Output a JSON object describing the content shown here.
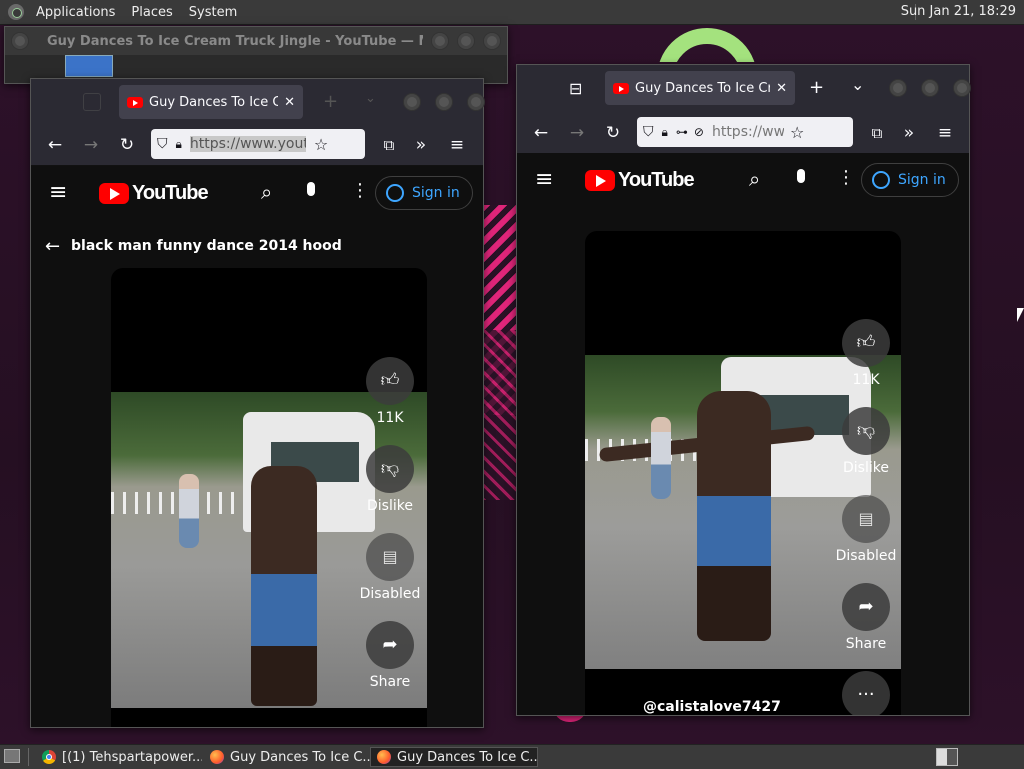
{
  "top_panel": {
    "applications": "Applications",
    "places": "Places",
    "system": "System",
    "clock": "Sun Jan 21, 18:29"
  },
  "back_window": {
    "title": "Guy Dances To Ice Cream Truck Jingle - YouTube — Mozilla..."
  },
  "left_window": {
    "tab_title": "Guy Dances To Ice Cream Truck Jingle - YouTube",
    "url": "https://www.youtube.com/shorts/",
    "youtube_logo": "YouTube",
    "sign_in": "Sign in",
    "search_query": "black man funny dance 2014 hood",
    "like_count": "11K",
    "dislike_label": "Dislike",
    "comments_label": "Disabled",
    "share_label": "Share"
  },
  "right_window": {
    "tab_title": "Guy Dances To Ice Cream Truck Jingle - YouTube",
    "url": "https://www.youtube.com/shorts/",
    "youtube_logo": "YouTube",
    "sign_in": "Sign in",
    "like_count": "11K",
    "dislike_label": "Dislike",
    "comments_label": "Disabled",
    "share_label": "Share",
    "channel": "@calistalove7427",
    "more_label": "···"
  },
  "taskbar": {
    "items": [
      {
        "label": "[(1) Tehspartapower..."
      },
      {
        "label": "Guy Dances To Ice C..."
      },
      {
        "label": "Guy Dances To Ice C..."
      }
    ]
  },
  "colors": {
    "yt_red": "#ff0000",
    "signin_blue": "#3ea6ff",
    "firefox_chrome": "#2b2a33",
    "desktop_bg": "#2a1226"
  },
  "icons": [
    "back-arrow-icon",
    "forward-arrow-icon",
    "reload-icon",
    "shield-icon",
    "lock-icon",
    "bookmark-star-icon",
    "extensions-icon",
    "overflow-icon",
    "hamburger-menu-icon",
    "search-icon",
    "mic-icon",
    "kebab-icon",
    "account-icon",
    "thumbs-up-icon",
    "thumbs-down-icon",
    "comment-icon",
    "share-icon",
    "more-icon"
  ]
}
